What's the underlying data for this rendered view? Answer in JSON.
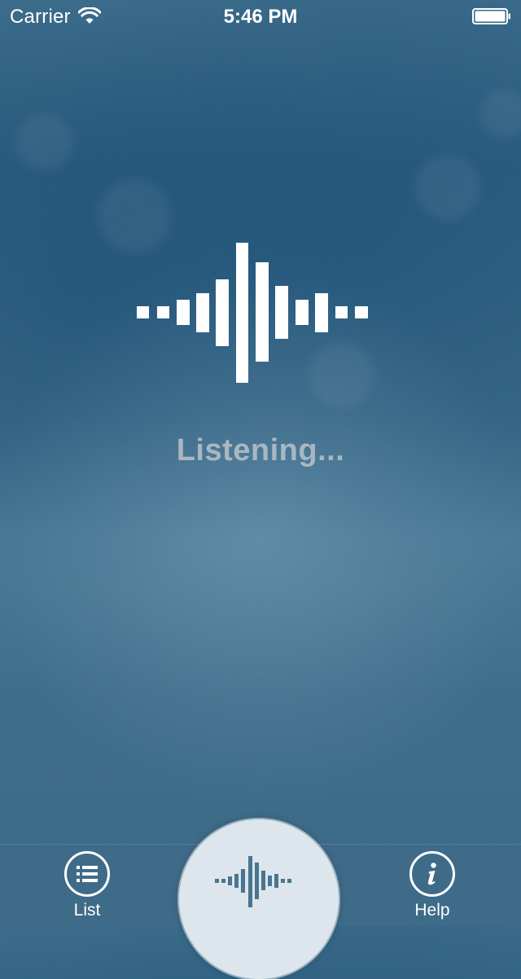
{
  "status_bar": {
    "carrier": "Carrier",
    "time": "5:46 PM"
  },
  "main": {
    "status_text": "Listening..."
  },
  "tab_bar": {
    "list_label": "List",
    "help_label": "Help",
    "center_icon": "waveform-icon"
  },
  "colors": {
    "background": "#3b6a88",
    "status_text": "#a8b7c1",
    "center_button": "#dce6ec",
    "center_icon": "#4a7590"
  }
}
